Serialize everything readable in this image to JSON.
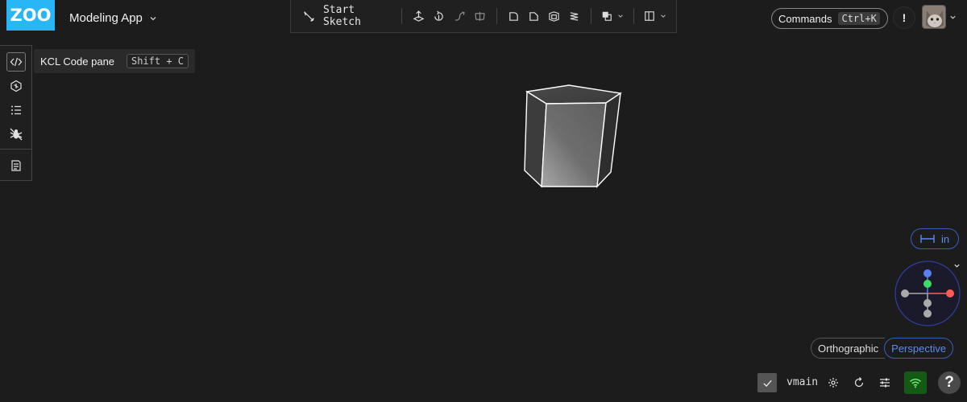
{
  "app": {
    "logo_text": "ZOO",
    "project_name": "Modeling App"
  },
  "toolbar": {
    "start_sketch_label": "Start Sketch",
    "tools": [
      "extrude-icon",
      "revolve-icon",
      "sweep-icon",
      "loft-icon",
      "fillet-icon",
      "chamfer-icon",
      "shell-icon",
      "helix-icon",
      "boolean-icon",
      "plane-icon"
    ]
  },
  "header": {
    "commands_label": "Commands",
    "commands_shortcut": "Ctrl+K",
    "notification_label": "!"
  },
  "left_rail": {
    "items": [
      "code-pane-icon",
      "features-icon",
      "variables-icon",
      "debug-icon",
      "logs-icon"
    ],
    "tooltip": {
      "label": "KCL Code pane",
      "shortcut": "Shift + C"
    }
  },
  "viewport": {
    "units_label": "in",
    "projection": {
      "options": [
        "Orthographic",
        "Perspective"
      ],
      "selected": "Perspective"
    },
    "axis_colors": {
      "x": "#ff5a5a",
      "y": "#3ddc62",
      "z": "#5b7ef0"
    }
  },
  "status_bar": {
    "branch": "vmain",
    "network": "connected"
  },
  "help_label": "?"
}
